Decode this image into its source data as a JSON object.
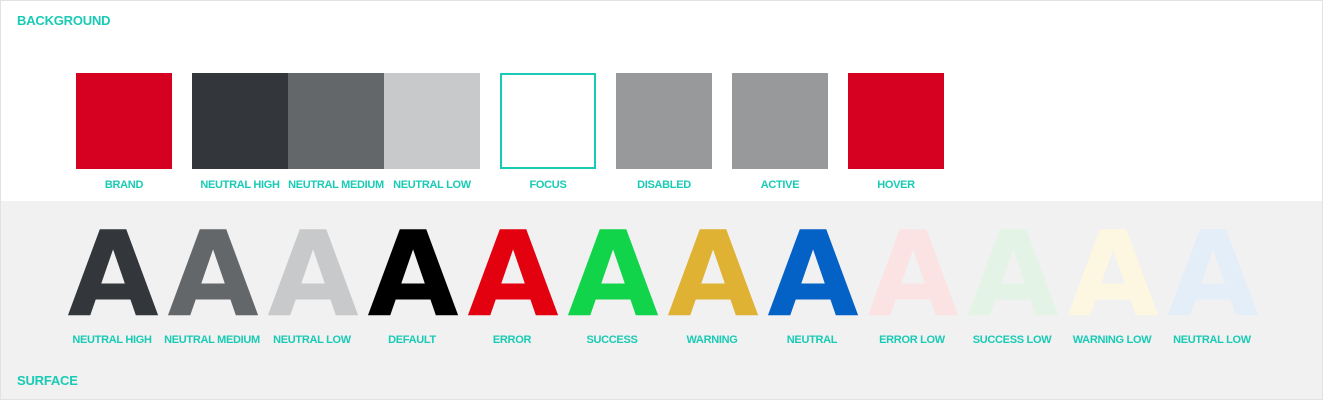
{
  "background": {
    "title": "BACKGROUND",
    "swatches": [
      {
        "label": "BRAND",
        "color": "#d60020"
      },
      {
        "label": "NEUTRAL HIGH",
        "color": "#33363a"
      },
      {
        "label": "NEUTRAL MEDIUM",
        "color": "#64676a"
      },
      {
        "label": "NEUTRAL LOW",
        "color": "#c8c9ca"
      },
      {
        "label": "FOCUS",
        "color": "#ffffff",
        "border": "#19cbb5"
      },
      {
        "label": "DISABLED",
        "color": "#98999a"
      },
      {
        "label": "ACTIVE",
        "color": "#98999a"
      },
      {
        "label": "HOVER",
        "color": "#d60020"
      }
    ]
  },
  "surface": {
    "title": "SURFACE",
    "glyph": "A",
    "letters": [
      {
        "label": "NEUTRAL HIGH",
        "color": "#33363a"
      },
      {
        "label": "NEUTRAL MEDIUM",
        "color": "#64676a"
      },
      {
        "label": "NEUTRAL LOW",
        "color": "#c8c9ca"
      },
      {
        "label": "DEFAULT",
        "color": "#000000"
      },
      {
        "label": "ERROR",
        "color": "#e3000f"
      },
      {
        "label": "SUCCESS",
        "color": "#12d44a"
      },
      {
        "label": "WARNING",
        "color": "#e0b234"
      },
      {
        "label": "NEUTRAL",
        "color": "#0461c5"
      },
      {
        "label": "ERROR LOW",
        "color": "#fbe3e4"
      },
      {
        "label": "SUCCESS LOW",
        "color": "#e3f4e6"
      },
      {
        "label": "WARNING LOW",
        "color": "#fdf6e1"
      },
      {
        "label": "NEUTRAL LOW",
        "color": "#e4eef9"
      }
    ]
  }
}
